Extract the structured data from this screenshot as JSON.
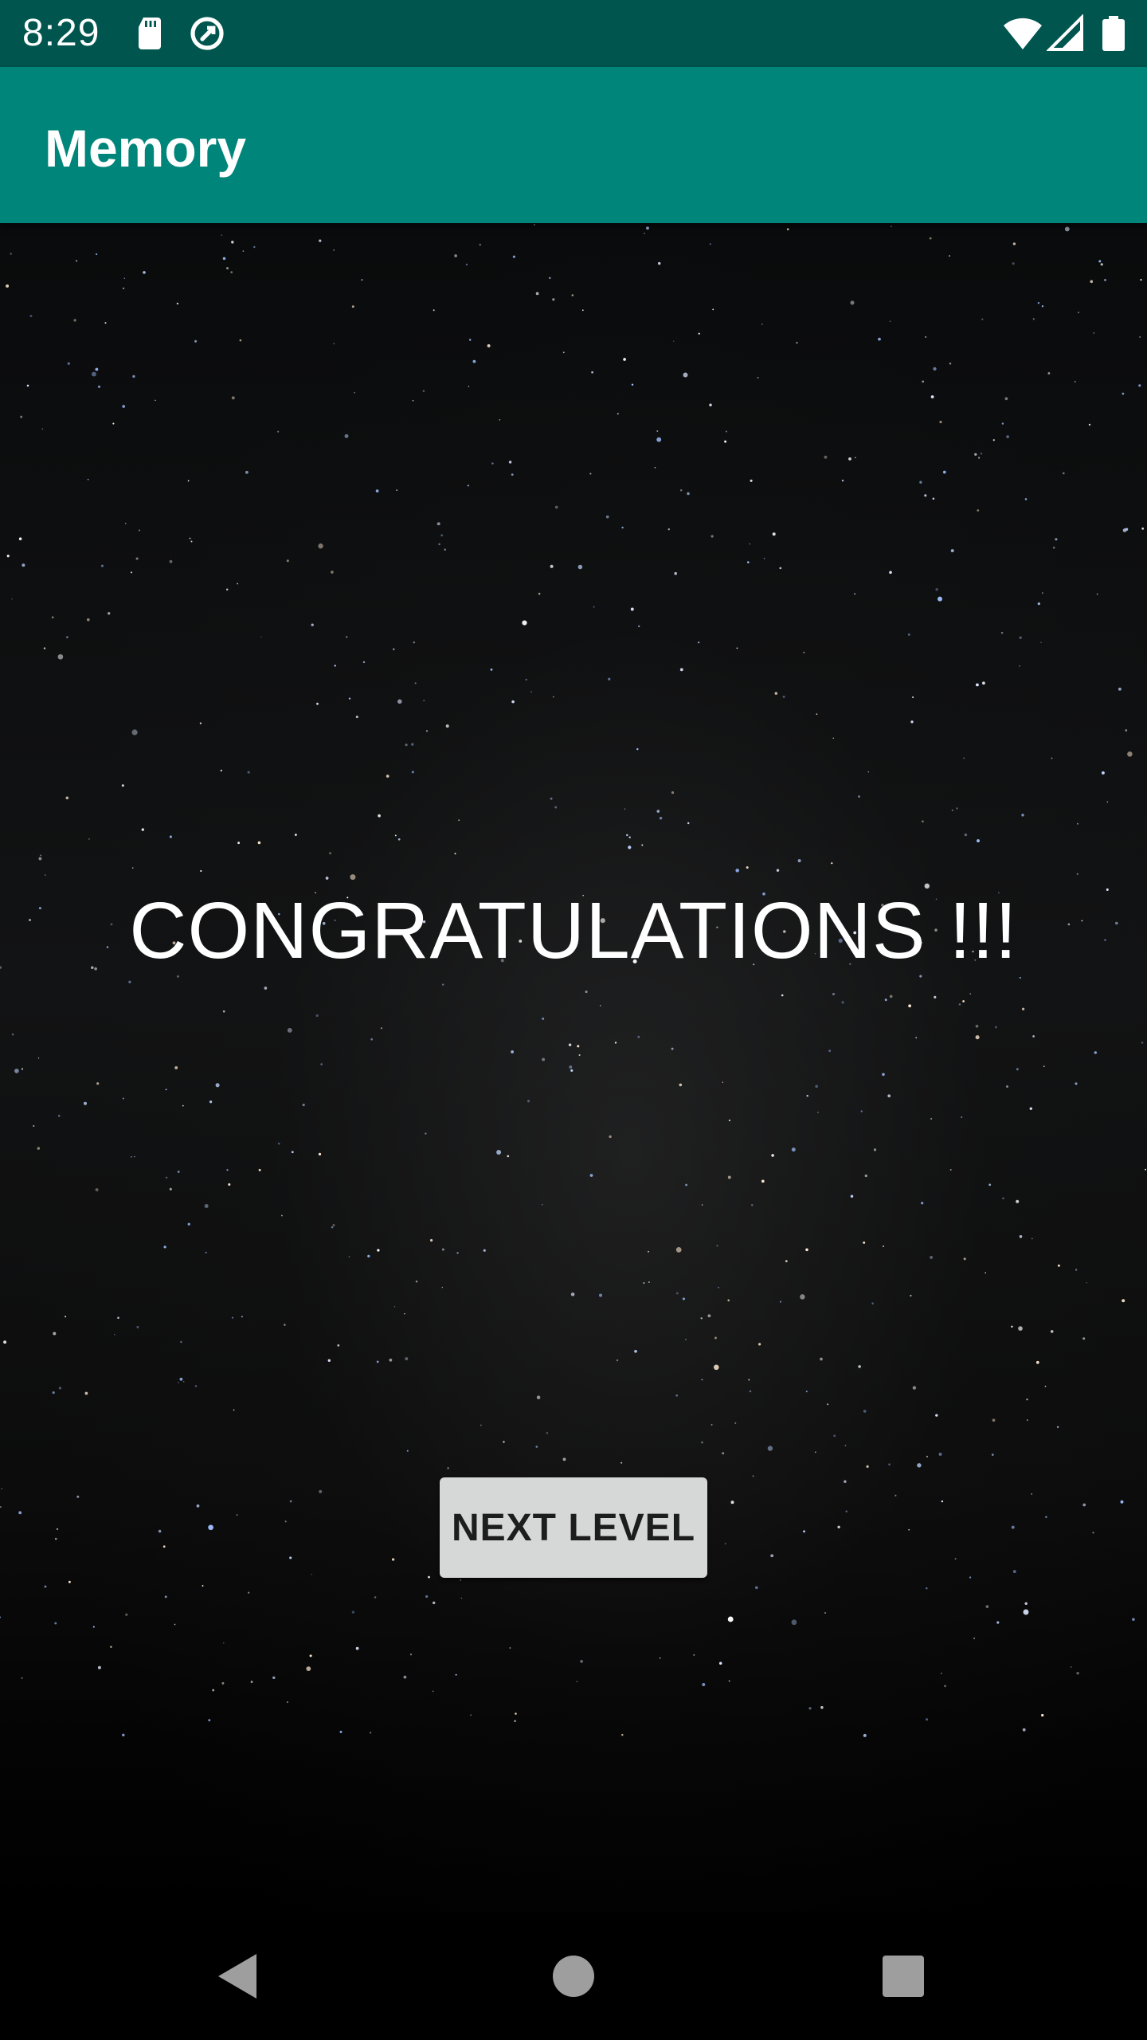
{
  "status_bar": {
    "time": "8:29",
    "icons": [
      "sd-card-icon",
      "sync-icon",
      "wifi-icon",
      "signal-icon",
      "battery-icon"
    ]
  },
  "app_bar": {
    "title": "Memory",
    "color": "#00857a",
    "status_color": "#00564f"
  },
  "main": {
    "message": "CONGRATULATIONS !!!",
    "next_button_label": "NEXT LEVEL"
  },
  "nav_bar": {
    "buttons": [
      "back-icon",
      "home-icon",
      "recents-icon"
    ]
  }
}
